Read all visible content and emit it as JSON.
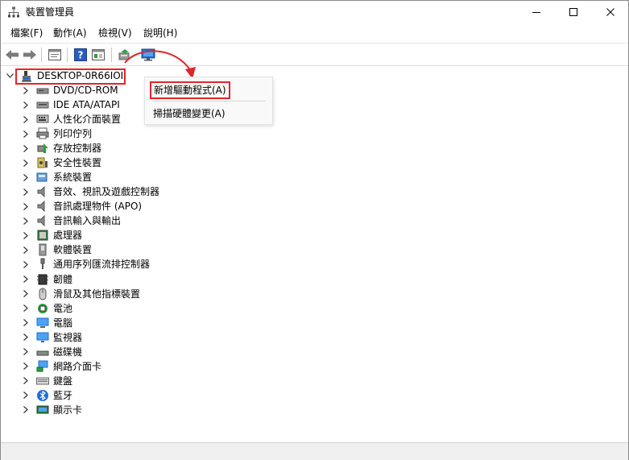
{
  "window": {
    "title": "裝置管理員"
  },
  "menu": [
    {
      "id": "file",
      "label": "檔案(F)"
    },
    {
      "id": "action",
      "label": "動作(A)"
    },
    {
      "id": "view",
      "label": "檢視(V)"
    },
    {
      "id": "help",
      "label": "說明(H)"
    }
  ],
  "toolbar": [
    {
      "name": "back-button",
      "icon": "back-arrow-icon"
    },
    {
      "name": "forward-button",
      "icon": "forward-arrow-icon"
    },
    {
      "name": "properties-button",
      "icon": "properties-icon"
    },
    {
      "name": "help-button",
      "icon": "help-icon"
    },
    {
      "name": "details-button",
      "icon": "details-pane-icon"
    },
    {
      "name": "update-driver-button",
      "icon": "update-driver-icon"
    },
    {
      "name": "scan-hardware-button",
      "icon": "monitor-scan-icon"
    }
  ],
  "tree": {
    "root": "DESKTOP-0R66IOI",
    "items": [
      {
        "label": "DVD/CD-ROM",
        "icon": "dvd-drive-icon"
      },
      {
        "label": "IDE ATA/ATAPI",
        "icon": "ide-controller-icon"
      },
      {
        "label": "人性化介面裝置",
        "icon": "hid-icon"
      },
      {
        "label": "列印佇列",
        "icon": "printer-icon"
      },
      {
        "label": "存放控制器",
        "icon": "storage-controller-icon"
      },
      {
        "label": "安全性裝置",
        "icon": "security-device-icon"
      },
      {
        "label": "系統裝置",
        "icon": "system-device-icon"
      },
      {
        "label": "音效、視訊及遊戲控制器",
        "icon": "speaker-icon"
      },
      {
        "label": "音訊處理物件 (APO)",
        "icon": "speaker-icon"
      },
      {
        "label": "音訊輸入與輸出",
        "icon": "speaker-icon"
      },
      {
        "label": "處理器",
        "icon": "processor-icon"
      },
      {
        "label": "軟體裝置",
        "icon": "software-device-icon"
      },
      {
        "label": "通用序列匯流排控制器",
        "icon": "usb-icon"
      },
      {
        "label": "韌體",
        "icon": "firmware-icon"
      },
      {
        "label": "滑鼠及其他指標裝置",
        "icon": "mouse-icon"
      },
      {
        "label": "電池",
        "icon": "battery-icon"
      },
      {
        "label": "電腦",
        "icon": "computer-icon"
      },
      {
        "label": "監視器",
        "icon": "monitor-icon"
      },
      {
        "label": "磁碟機",
        "icon": "disk-drive-icon"
      },
      {
        "label": "網路介面卡",
        "icon": "network-adapter-icon"
      },
      {
        "label": "鍵盤",
        "icon": "keyboard-icon"
      },
      {
        "label": "藍牙",
        "icon": "bluetooth-icon"
      },
      {
        "label": "顯示卡",
        "icon": "display-adapter-icon"
      }
    ]
  },
  "context_menu": {
    "add_driver": "新增驅動程式(A)",
    "scan_hardware": "掃描硬體變更(A)"
  },
  "colors": {
    "highlight": "#e2252a",
    "accent": "#1e6fd0"
  }
}
